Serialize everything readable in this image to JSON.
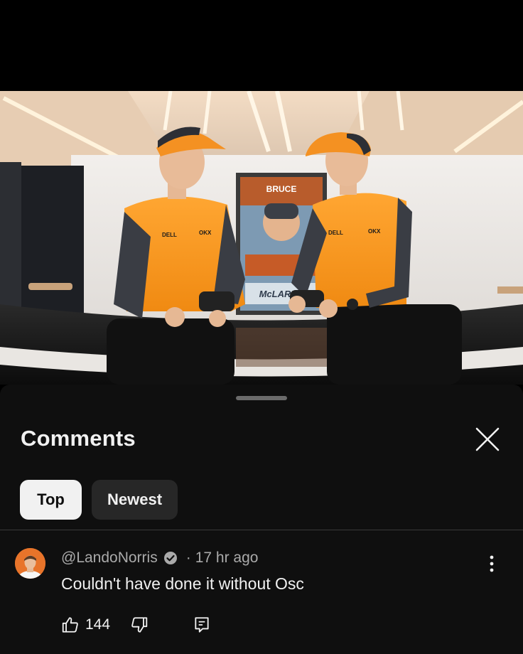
{
  "video": {
    "poster_text": "BRUCE",
    "jersey_sponsor_1": "DELL",
    "jersey_sponsor_2": "OKX",
    "poster_brand": "McLAREN"
  },
  "comments_sheet": {
    "title": "Comments",
    "filters": [
      {
        "label": "Top",
        "active": true
      },
      {
        "label": "Newest",
        "active": false
      }
    ]
  },
  "comment": {
    "author": "@LandoNorris",
    "separator": "·",
    "time": "17 hr ago",
    "text": "Couldn't have done it without Osc",
    "likes": "144"
  },
  "icons": {
    "close": "close-icon",
    "verified": "verified-check-icon",
    "more": "more-vertical-icon",
    "like": "thumbs-up-icon",
    "dislike": "thumbs-down-icon",
    "reply": "reply-icon"
  },
  "colors": {
    "sheet_bg": "#0f0f0f",
    "chip_active": "#f1f1f1",
    "chip_inactive": "#272727",
    "secondary_text": "#aaaaaa",
    "papaya": "#f7941d"
  }
}
